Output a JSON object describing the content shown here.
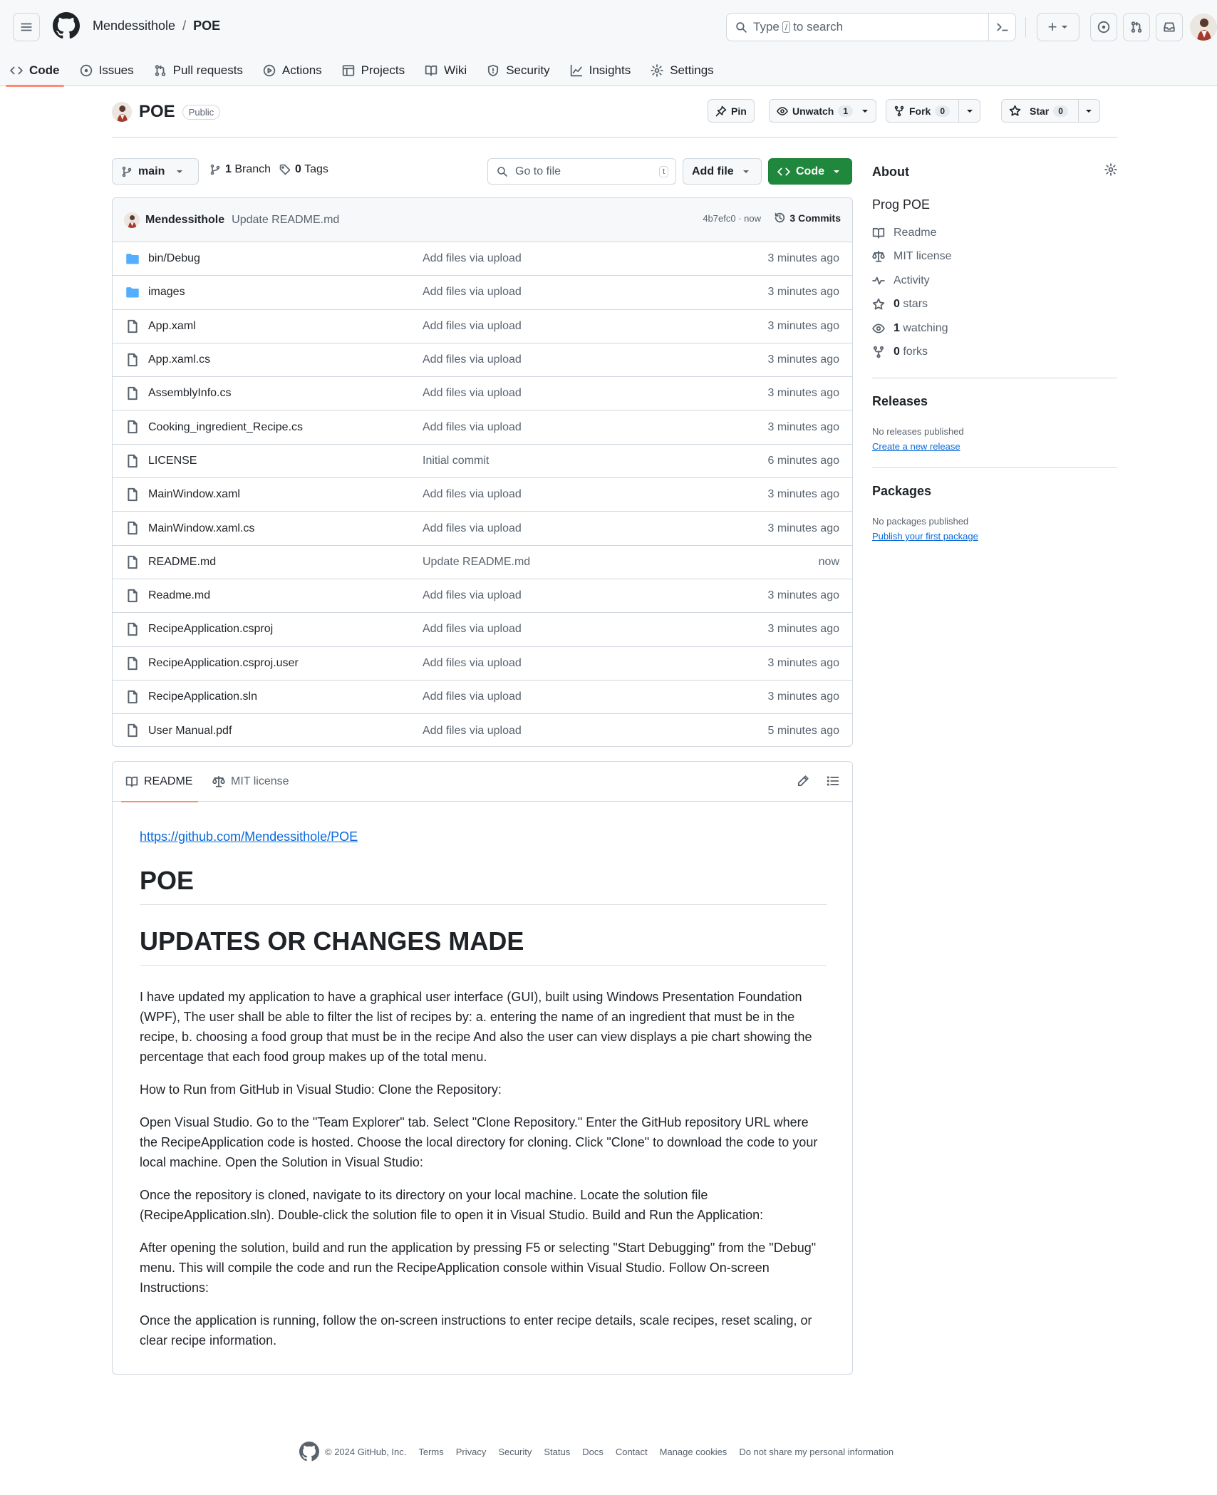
{
  "header": {
    "owner": "Mendessithole",
    "separator": "/",
    "repo": "POE",
    "search_placeholder_before": "Type",
    "search_key": "/",
    "search_placeholder_after": "to search",
    "plus_label": "+"
  },
  "repo_nav": {
    "tabs": [
      {
        "label": "Code",
        "icon": "code-icon",
        "active": true
      },
      {
        "label": "Issues",
        "icon": "issue-icon"
      },
      {
        "label": "Pull requests",
        "icon": "pull-request-icon"
      },
      {
        "label": "Actions",
        "icon": "play-icon"
      },
      {
        "label": "Projects",
        "icon": "table-icon"
      },
      {
        "label": "Wiki",
        "icon": "book-icon"
      },
      {
        "label": "Security",
        "icon": "shield-icon"
      },
      {
        "label": "Insights",
        "icon": "graph-icon"
      },
      {
        "label": "Settings",
        "icon": "gear-icon"
      }
    ]
  },
  "repo_head": {
    "name": "POE",
    "visibility": "Public",
    "pin_label": "Pin",
    "unwatch_label": "Unwatch",
    "watch_count": "1",
    "fork_label": "Fork",
    "fork_count": "0",
    "star_label": "Star",
    "star_count": "0"
  },
  "file_nav": {
    "branch": "main",
    "branches_count": "1",
    "branches_label": "Branch",
    "tags_count": "0",
    "tags_label": "Tags",
    "goto_placeholder": "Go to file",
    "goto_key": "t",
    "add_file_label": "Add file",
    "code_label": "Code"
  },
  "latest_commit": {
    "author": "Mendessithole",
    "message": "Update README.md",
    "meta": "4b7efc0 · now",
    "commits_label": "3 Commits"
  },
  "files": [
    {
      "name": "bin/Debug",
      "type": "folder",
      "message": "Add files via upload",
      "time": "3 minutes ago"
    },
    {
      "name": "images",
      "type": "folder",
      "message": "Add files via upload",
      "time": "3 minutes ago"
    },
    {
      "name": "App.xaml",
      "type": "file",
      "message": "Add files via upload",
      "time": "3 minutes ago"
    },
    {
      "name": "App.xaml.cs",
      "type": "file",
      "message": "Add files via upload",
      "time": "3 minutes ago"
    },
    {
      "name": "AssemblyInfo.cs",
      "type": "file",
      "message": "Add files via upload",
      "time": "3 minutes ago"
    },
    {
      "name": "Cooking_ingredient_Recipe.cs",
      "type": "file",
      "message": "Add files via upload",
      "time": "3 minutes ago"
    },
    {
      "name": "LICENSE",
      "type": "file",
      "message": "Initial commit",
      "time": "6 minutes ago"
    },
    {
      "name": "MainWindow.xaml",
      "type": "file",
      "message": "Add files via upload",
      "time": "3 minutes ago"
    },
    {
      "name": "MainWindow.xaml.cs",
      "type": "file",
      "message": "Add files via upload",
      "time": "3 minutes ago"
    },
    {
      "name": "README.md",
      "type": "file",
      "message": "Update README.md",
      "time": "now"
    },
    {
      "name": "Readme.md",
      "type": "file",
      "message": "Add files via upload",
      "time": "3 minutes ago"
    },
    {
      "name": "RecipeApplication.csproj",
      "type": "file",
      "message": "Add files via upload",
      "time": "3 minutes ago"
    },
    {
      "name": "RecipeApplication.csproj.user",
      "type": "file",
      "message": "Add files via upload",
      "time": "3 minutes ago"
    },
    {
      "name": "RecipeApplication.sln",
      "type": "file",
      "message": "Add files via upload",
      "time": "3 minutes ago"
    },
    {
      "name": "User Manual.pdf",
      "type": "file",
      "message": "Add files via upload",
      "time": "5 minutes ago"
    }
  ],
  "readme": {
    "tab_readme": "README",
    "tab_license": "MIT license",
    "link": "https://github.com/Mendessithole/POE",
    "h1_title": "POE",
    "h1_updates": "UPDATES OR CHANGES MADE",
    "paragraphs": [
      "I have updated my application to have a graphical user interface (GUI), built using Windows Presentation Foundation (WPF), The user shall be able to filter the list of recipes by: a. entering the name of an ingredient that must be in the recipe, b. choosing a food group that must be in the recipe And also the user can view displays a pie chart showing the percentage that each food group makes up of the total menu.",
      "How to Run from GitHub in Visual Studio: Clone the Repository:",
      "Open Visual Studio. Go to the \"Team Explorer\" tab. Select \"Clone Repository.\" Enter the GitHub repository URL where the RecipeApplication code is hosted. Choose the local directory for cloning. Click \"Clone\" to download the code to your local machine. Open the Solution in Visual Studio:",
      "Once the repository is cloned, navigate to its directory on your local machine. Locate the solution file (RecipeApplication.sln). Double-click the solution file to open it in Visual Studio. Build and Run the Application:",
      "After opening the solution, build and run the application by pressing F5 or selecting \"Start Debugging\" from the \"Debug\" menu. This will compile the code and run the RecipeApplication console within Visual Studio. Follow On-screen Instructions:",
      "Once the application is running, follow the on-screen instructions to enter recipe details, scale recipes, reset scaling, or clear recipe information."
    ]
  },
  "sidebar": {
    "about_heading": "About",
    "description": "Prog POE",
    "readme": "Readme",
    "license": "MIT license",
    "activity": "Activity",
    "stars_count": "0",
    "stars_label": "stars",
    "watching_count": "1",
    "watching_label": "watching",
    "forks_count": "0",
    "forks_label": "forks",
    "releases_heading": "Releases",
    "releases_note": "No releases published",
    "releases_link": "Create a new release",
    "packages_heading": "Packages",
    "packages_note": "No packages published",
    "packages_link": "Publish your first package"
  },
  "footer": {
    "copyright": "© 2024 GitHub, Inc.",
    "links": [
      "Terms",
      "Privacy",
      "Security",
      "Status",
      "Docs",
      "Contact",
      "Manage cookies",
      "Do not share my personal information"
    ]
  },
  "colors": {
    "accent_green": "#1f883d",
    "link_blue": "#0969da",
    "active_tab_underline": "#fd8c73",
    "folder_blue": "#54aeff",
    "header_bg": "#f6f8fa"
  }
}
